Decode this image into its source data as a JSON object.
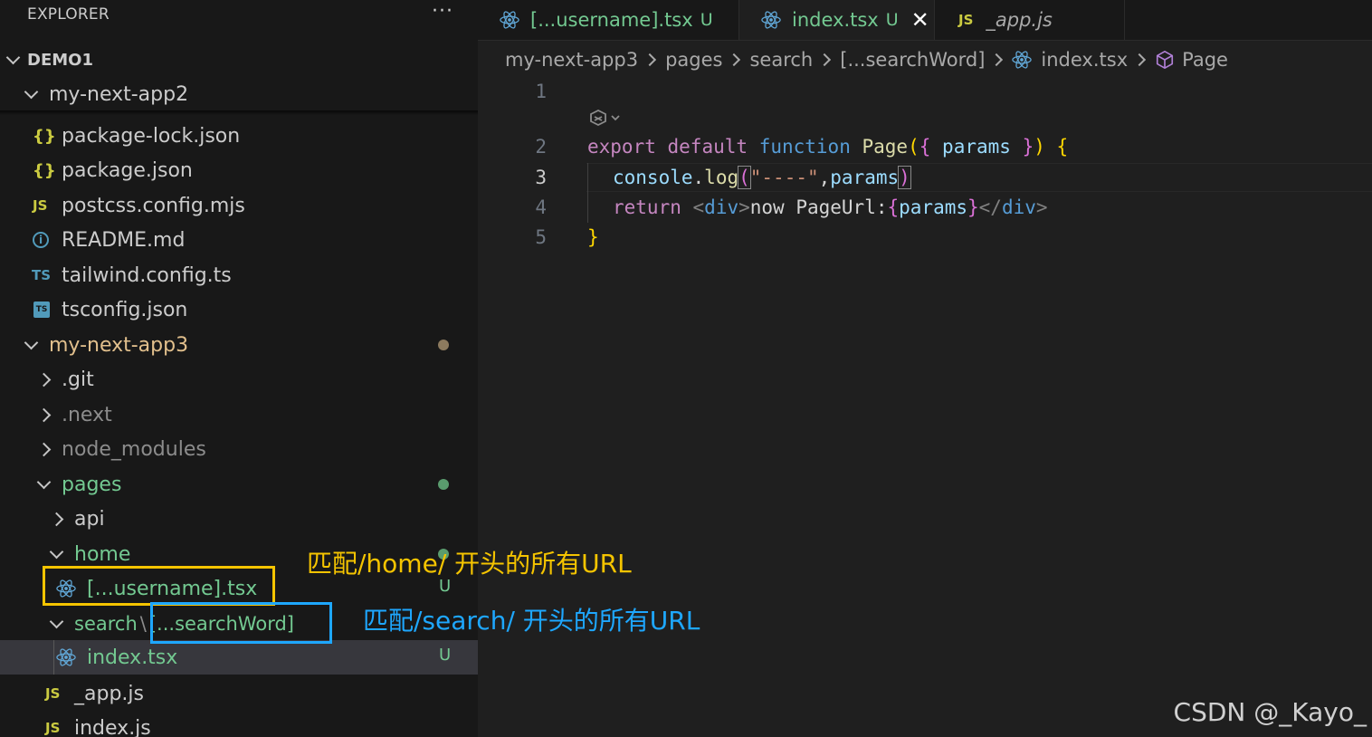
{
  "sidebar": {
    "title": "EXPLORER",
    "more_label": "···",
    "root_label": "DEMO1",
    "tree": [
      {
        "label": "my-next-app2",
        "icon": "chevron-down-icon",
        "name": "folder-my-next-app2"
      },
      {
        "label": "package-lock.json",
        "icon": "json-icon",
        "icon_text": "{}",
        "name": "file-package-lock-json"
      },
      {
        "label": "package.json",
        "icon": "json-icon",
        "icon_text": "{}",
        "name": "file-package-json"
      },
      {
        "label": "postcss.config.mjs",
        "icon": "js-icon",
        "icon_text": "JS",
        "name": "file-postcss-config"
      },
      {
        "label": "README.md",
        "icon": "info-icon",
        "icon_text": "i",
        "name": "file-readme"
      },
      {
        "label": "tailwind.config.ts",
        "icon": "ts-icon",
        "icon_text": "TS",
        "name": "file-tailwind-config"
      },
      {
        "label": "tsconfig.json",
        "icon": "tsconfig-icon",
        "icon_text": "TS",
        "name": "file-tsconfig"
      },
      {
        "label": "my-next-app3",
        "icon": "chevron-down-icon",
        "name": "folder-my-next-app3"
      },
      {
        "label": ".git",
        "icon": "chevron-right-icon",
        "name": "folder-git"
      },
      {
        "label": ".next",
        "icon": "chevron-right-icon",
        "name": "folder-next"
      },
      {
        "label": "node_modules",
        "icon": "chevron-right-icon",
        "name": "folder-node-modules"
      },
      {
        "label": "pages",
        "icon": "chevron-down-icon",
        "name": "folder-pages"
      },
      {
        "label": "api",
        "icon": "chevron-right-icon",
        "name": "folder-api"
      },
      {
        "label": "home",
        "icon": "chevron-down-icon",
        "name": "folder-home"
      },
      {
        "label": "[...username].tsx",
        "icon": "react-icon",
        "badge": "U",
        "name": "file-username-tsx"
      },
      {
        "label_a": "search",
        "label_sep": "\\",
        "label_b": "[...searchWord]",
        "icon": "chevron-down-icon",
        "name": "folder-search-searchword"
      },
      {
        "label": "index.tsx",
        "icon": "react-icon",
        "badge": "U",
        "name": "file-index-tsx"
      },
      {
        "label": "_app.js",
        "icon": "js-icon",
        "icon_text": "JS",
        "name": "file-app-js"
      },
      {
        "label": "index.js",
        "icon": "js-icon",
        "icon_text": "JS",
        "name": "file-index-js"
      }
    ]
  },
  "tabs": [
    {
      "label": "[...username].tsx",
      "status": "U",
      "icon": "react-icon",
      "active": false
    },
    {
      "label": "index.tsx",
      "status": "U",
      "icon": "react-icon",
      "active": true,
      "close": "✕"
    },
    {
      "label": "_app.js",
      "icon": "js-icon",
      "icon_text": "JS",
      "active": false
    }
  ],
  "breadcrumb": [
    "my-next-app3",
    "pages",
    "search",
    "[...searchWord]",
    "index.tsx",
    "Page"
  ],
  "code": {
    "line_numbers": [
      "1",
      "2",
      "3",
      "4",
      "5"
    ],
    "current_line": "3",
    "tokens": {
      "export": "export",
      "default": "default",
      "function": "function",
      "fn_name": "Page",
      "paren_open": "(",
      "brace_open": "{",
      "params": "params",
      "brace_close": "}",
      "paren_close": ")",
      "block_open": "{",
      "console": "console",
      "dot": ".",
      "log": "log",
      "log_open": "(",
      "str": "\"----\"",
      "comma": ",",
      "log_close": ")",
      "return": "return",
      "lt": "<",
      "div": "div",
      "gt": ">",
      "jsx_text": "now PageUrl:",
      "jsx_open": "{",
      "jsx_close": "}",
      "lt_slash": "</",
      "block_close": "}"
    }
  },
  "annotations": {
    "home_note": "匹配/home/ 开头的所有URL",
    "search_note": "匹配/search/  开头的所有URL",
    "home_color": "#f5c400",
    "search_color": "#1ea7ff"
  },
  "watermark": "CSDN @_Kayo_"
}
